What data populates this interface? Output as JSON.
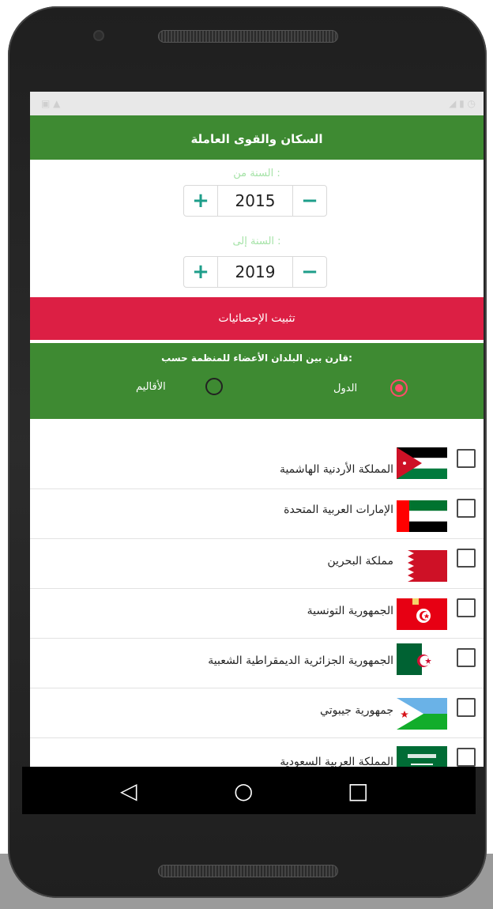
{
  "title": "السكان والقوى العاملة",
  "year_from": {
    "label": "السنة من :",
    "value": "2015",
    "plus": "+",
    "minus": "−"
  },
  "year_to": {
    "label": "السنة إلى :",
    "value": "2019",
    "plus": "+",
    "minus": "−"
  },
  "pin_stats_label": "تثبيت الإحصائيات",
  "compare_prompt": "قارن بين البلدان الأعضاء للمنظمة حسب:",
  "radio_options": {
    "countries": "الدول",
    "regions": "الأقاليم"
  },
  "countries": [
    {
      "name": "المملكة الأردنية الهاشمية",
      "flag": "jordan-flag-icon"
    },
    {
      "name": "الإمارات العربية المتحدة",
      "flag": "uae-flag-icon"
    },
    {
      "name": "مملكة البحرين",
      "flag": "bahrain-flag-icon"
    },
    {
      "name": "الجمهورية التونسية",
      "flag": "tunisia-flag-icon"
    },
    {
      "name": "الجمهورية الجزائرية الديمقراطية الشعبية",
      "flag": "algeria-flag-icon"
    },
    {
      "name": "جمهورية جيبوتي",
      "flag": "djibouti-flag-icon"
    },
    {
      "name": "المملكة العربية السعودية",
      "flag": "saudi-flag-icon"
    }
  ],
  "nav": {
    "back": "◁",
    "home": "○",
    "recents": "□"
  },
  "colors": {
    "green": "#3e8a32",
    "red": "#dc1f44",
    "accent": "#ff4d6a",
    "teal": "#1e9e8a"
  }
}
